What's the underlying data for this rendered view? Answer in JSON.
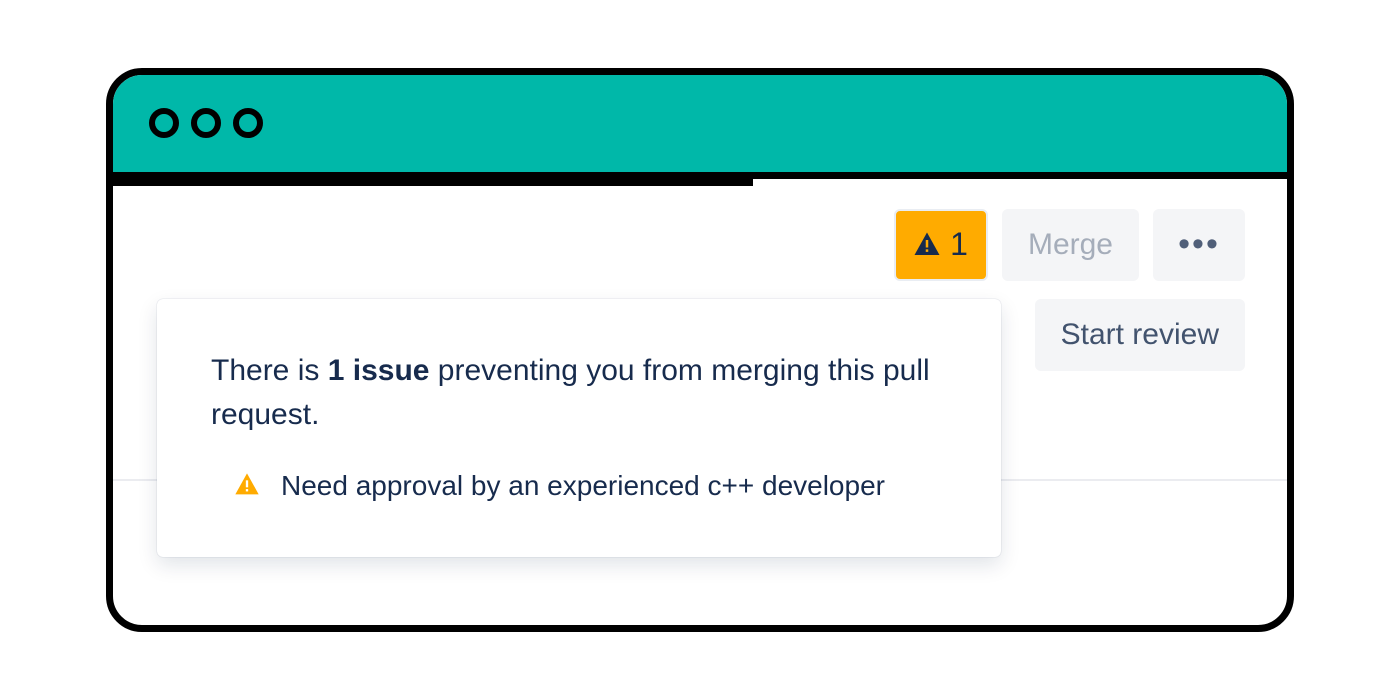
{
  "colors": {
    "titlebar": "#00B8A9",
    "warning": "#FFAB00",
    "text": "#172B4D"
  },
  "toolbar": {
    "issue_count": "1",
    "merge_label": "Merge",
    "more_label": "•••",
    "start_review_label": "Start review"
  },
  "popover": {
    "heading_before": "There is ",
    "heading_bold": "1 issue",
    "heading_after": " preventing you from merging this pull request.",
    "issues": [
      {
        "text": "Need approval by an experienced c++ developer"
      }
    ]
  }
}
